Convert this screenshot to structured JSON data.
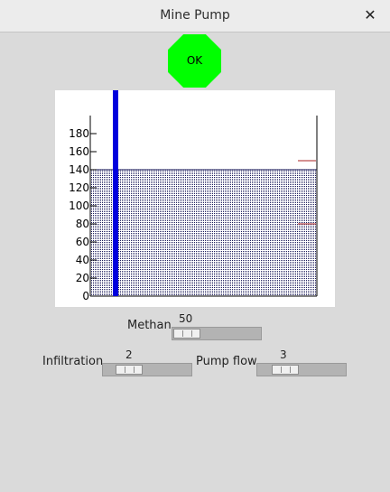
{
  "window": {
    "title": "Mine Pump",
    "close_glyph": "✕"
  },
  "status_button": {
    "label": "OK",
    "color": "#00ff00"
  },
  "chart_data": {
    "type": "bar",
    "y_ticks": [
      "180",
      "160",
      "140",
      "120",
      "100",
      "80",
      "60",
      "40",
      "20",
      "0"
    ],
    "ylim": [
      0,
      200
    ],
    "water_level": 140,
    "methane_bar_value": 200,
    "high_mark": 150,
    "low_mark": 80,
    "colors": {
      "water": "#1a1a5a",
      "methane": "#0000dd",
      "marks": "#aa2222"
    }
  },
  "controls": {
    "methane": {
      "label": "Methan",
      "value": "50"
    },
    "infiltration": {
      "label": "Infiltration",
      "value": "2"
    },
    "pump_flow": {
      "label": "Pump flow",
      "value": "3"
    }
  }
}
